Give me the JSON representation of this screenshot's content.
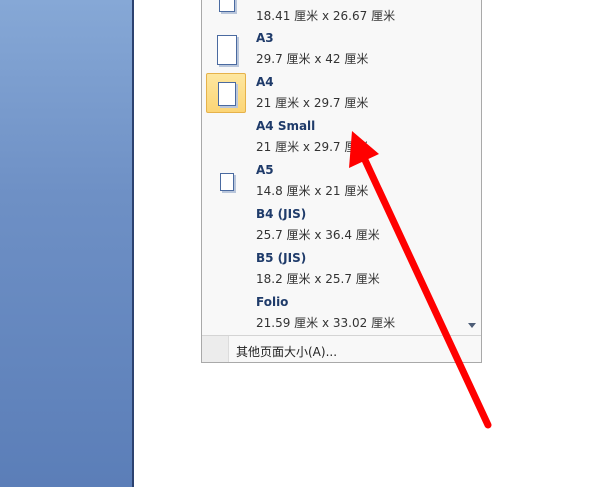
{
  "paper_sizes": [
    {
      "name": "",
      "dims": "18.41 厘米 x 26.67 厘米"
    },
    {
      "name": "A3",
      "dims": "29.7 厘米 x 42 厘米"
    },
    {
      "name": "A4",
      "dims": "21 厘米 x 29.7 厘米",
      "selected": true
    },
    {
      "name": "A4 Small",
      "dims": "21 厘米 x 29.7 厘米"
    },
    {
      "name": "A5",
      "dims": "14.8 厘米 x 21 厘米"
    },
    {
      "name": "B4 (JIS)",
      "dims": "25.7 厘米 x 36.4 厘米"
    },
    {
      "name": "B5 (JIS)",
      "dims": "18.2 厘米 x 25.7 厘米"
    },
    {
      "name": "Folio",
      "dims": "21.59 厘米 x 33.02 厘米"
    }
  ],
  "more_sizes_label": "其他页面大小(A)...",
  "colors": {
    "arrow": "#ff0000",
    "selected_bg": "#fcd576",
    "left_panel": "#6e90c5"
  },
  "icons": {
    "page": "page-icon",
    "scroll_down": "chevron-down-icon"
  }
}
